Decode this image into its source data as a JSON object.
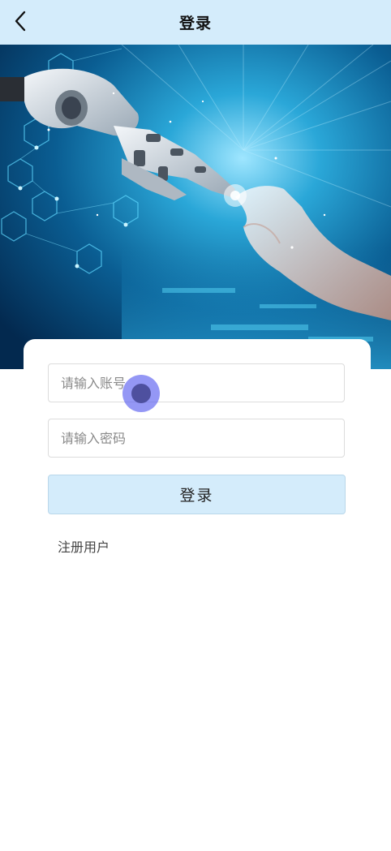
{
  "header": {
    "title": "登录",
    "back_icon": "chevron-left-icon",
    "background": "#d4ecfb"
  },
  "banner": {
    "image": "robot-hand-touching-human-hand"
  },
  "form": {
    "account_placeholder": "请输入账号",
    "password_placeholder": "请输入密码",
    "login_label": "登录",
    "register_label": "注册用户"
  },
  "colors": {
    "accent": "#d4ecfb",
    "touch_indicator": "#5a5ff0"
  }
}
